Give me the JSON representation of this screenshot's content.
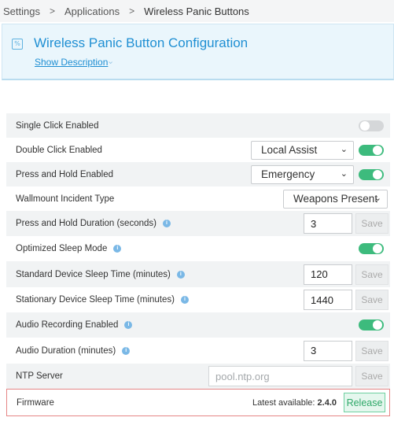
{
  "breadcrumb": {
    "items": [
      "Settings",
      "Applications",
      "Wireless Panic Buttons"
    ],
    "separator": ">"
  },
  "header": {
    "icon": "settings-app-icon",
    "title": "Wireless Panic Button Configuration",
    "show_description": "Show Description",
    "chevron": "⌄"
  },
  "settings": {
    "single_click": {
      "label": "Single Click Enabled",
      "enabled": false
    },
    "double_click": {
      "label": "Double Click Enabled",
      "action": "Local Assist",
      "enabled": true
    },
    "press_hold": {
      "label": "Press and Hold Enabled",
      "action": "Emergency",
      "enabled": true
    },
    "wallmount": {
      "label": "Wallmount Incident Type",
      "value": "Weapons Present"
    },
    "press_hold_duration": {
      "label": "Press and Hold Duration (seconds)",
      "value": "3",
      "save": "Save"
    },
    "optimized_sleep": {
      "label": "Optimized Sleep Mode",
      "enabled": true
    },
    "standard_sleep": {
      "label": "Standard Device Sleep Time (minutes)",
      "value": "120",
      "save": "Save"
    },
    "stationary_sleep": {
      "label": "Stationary Device Sleep Time (minutes)",
      "value": "1440",
      "save": "Save"
    },
    "audio_recording": {
      "label": "Audio Recording Enabled",
      "enabled": true
    },
    "audio_duration": {
      "label": "Audio Duration (minutes)",
      "value": "3",
      "save": "Save"
    },
    "ntp_server": {
      "label": "NTP Server",
      "placeholder": "pool.ntp.org",
      "save": "Save"
    }
  },
  "firmware": {
    "label": "Firmware",
    "latest_prefix": "Latest available:",
    "latest_version": "2.4.0",
    "release": "Release"
  },
  "colors": {
    "accent": "#1f8fd3",
    "toggle_on": "#3dbb7d",
    "toggle_off": "#d5d7d9",
    "firmware_border": "#e58585",
    "release_text": "#2ea868"
  }
}
